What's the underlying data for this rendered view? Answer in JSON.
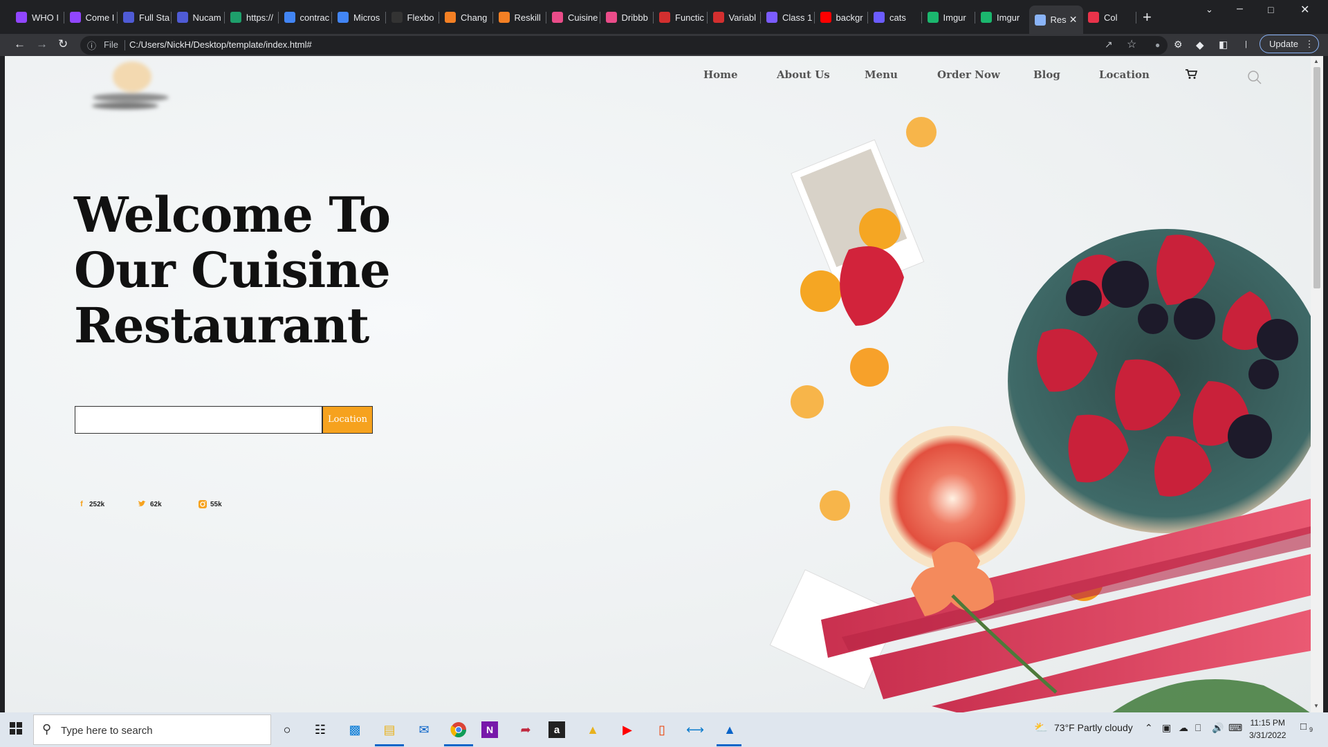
{
  "browser": {
    "tabs": [
      {
        "label": "WHO I",
        "color": "#9146ff"
      },
      {
        "label": "Come I",
        "color": "#9146ff"
      },
      {
        "label": "Full Sta",
        "color": "#4f5bd5"
      },
      {
        "label": "Nucam",
        "color": "#4f5bd5"
      },
      {
        "label": "https://",
        "color": "#1e9f6b"
      },
      {
        "label": "contrac",
        "color": "#4285f4"
      },
      {
        "label": "Micros",
        "color": "#4285f4"
      },
      {
        "label": "Flexbo",
        "color": "#333333"
      },
      {
        "label": "Chang",
        "color": "#f48024"
      },
      {
        "label": "Reskill",
        "color": "#f48024"
      },
      {
        "label": "Cuisine",
        "color": "#ea4c89"
      },
      {
        "label": "Dribbb",
        "color": "#ea4c89"
      },
      {
        "label": "Functic",
        "color": "#d32f2f"
      },
      {
        "label": "Variabl",
        "color": "#d32f2f"
      },
      {
        "label": "Class 1",
        "color": "#7b5cff"
      },
      {
        "label": "backgr",
        "color": "#ff0000"
      },
      {
        "label": "cats",
        "color": "#6b5cff"
      },
      {
        "label": "Imgur",
        "color": "#1bb76e"
      },
      {
        "label": "Imgur",
        "color": "#1bb76e"
      },
      {
        "label": "Res",
        "color": "#8ab4f8"
      },
      {
        "label": "Col",
        "color": "#e8334a"
      }
    ],
    "file_label": "File",
    "url": "C:/Users/NickH/Desktop/template/index.html#",
    "update_label": "Update"
  },
  "site": {
    "nav": [
      "Home",
      "About Us",
      "Menu",
      "Order Now",
      "Blog",
      "Location"
    ],
    "hero_lines": [
      "Welcome To",
      "Our Cuisine",
      "Restaurant"
    ],
    "search_value": "",
    "location_button": "Location",
    "social": [
      {
        "icon": "facebook-icon",
        "count": "252k",
        "color": "#f6a21e"
      },
      {
        "icon": "twitter-icon",
        "count": "62k",
        "color": "#f6a21e"
      },
      {
        "icon": "instagram-icon",
        "count": "55k",
        "color": "#f6a21e"
      }
    ],
    "accent_color": "#f6a21e"
  },
  "taskbar": {
    "search_placeholder": "Type here to search",
    "weather": "73°F  Partly cloudy",
    "time": "11:15 PM",
    "date": "3/31/2022",
    "notifications": "9"
  }
}
